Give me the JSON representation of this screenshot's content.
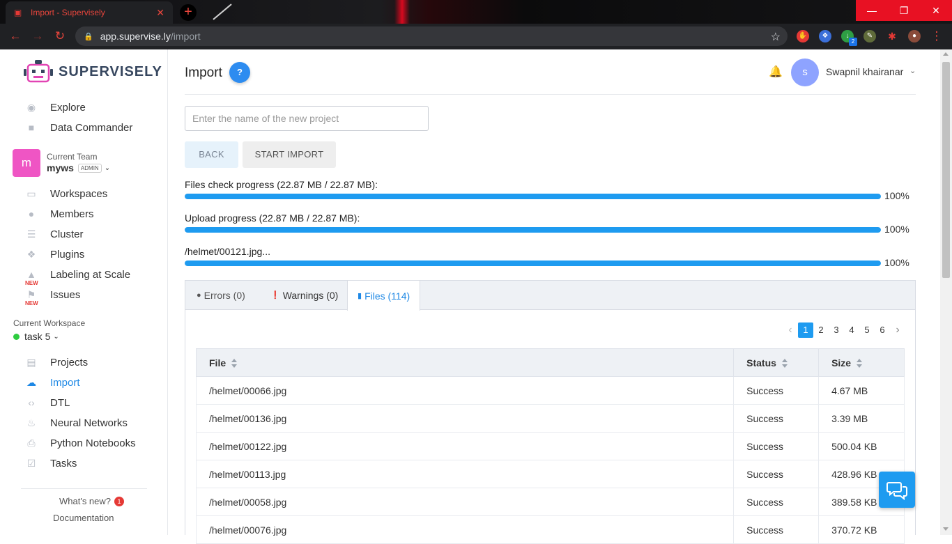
{
  "browser": {
    "tab_title": "Import - Supervisely",
    "url_host": "app.supervise.ly",
    "url_path": "/import",
    "extension_badge": "2"
  },
  "sidebar": {
    "brand": "SUPERVISELY",
    "top_items": [
      {
        "label": "Explore",
        "icon": "globe-icon"
      },
      {
        "label": "Data Commander",
        "icon": "folder-icon"
      }
    ],
    "team": {
      "caption": "Current Team",
      "avatar_letter": "m",
      "name": "myws",
      "role": "ADMIN"
    },
    "team_items": [
      {
        "label": "Workspaces",
        "icon": "monitor-icon"
      },
      {
        "label": "Members",
        "icon": "members-icon"
      },
      {
        "label": "Cluster",
        "icon": "cluster-icon"
      },
      {
        "label": "Plugins",
        "icon": "puzzle-icon"
      },
      {
        "label": "Labeling at Scale",
        "icon": "graduation-cap-icon",
        "tag": "NEW"
      },
      {
        "label": "Issues",
        "icon": "flag-icon",
        "tag": "NEW"
      }
    ],
    "workspace": {
      "caption": "Current Workspace",
      "name": "task 5"
    },
    "workspace_items": [
      {
        "label": "Projects",
        "icon": "images-icon"
      },
      {
        "label": "Import",
        "icon": "cloud-upload-icon",
        "active": true
      },
      {
        "label": "DTL",
        "icon": "code-icon"
      },
      {
        "label": "Neural Networks",
        "icon": "fire-icon"
      },
      {
        "label": "Python Notebooks",
        "icon": "printer-icon"
      },
      {
        "label": "Tasks",
        "icon": "checkbox-icon"
      }
    ],
    "whats_new": "What's new?",
    "whats_new_count": "1",
    "documentation": "Documentation"
  },
  "header": {
    "title": "Import",
    "help": "?",
    "user_initial": "s",
    "user_name": "Swapnil khairanar"
  },
  "form": {
    "project_placeholder": "Enter the name of the new project",
    "project_value": "",
    "back_label": "BACK",
    "start_label": "START IMPORT"
  },
  "progress": [
    {
      "label": "Files check progress (22.87 MB / 22.87 MB):",
      "percent": 100,
      "text": "100%"
    },
    {
      "label": "Upload progress (22.87 MB / 22.87 MB):",
      "percent": 100,
      "text": "100%"
    },
    {
      "label": "/helmet/00121.jpg...",
      "percent": 100,
      "text": "100%"
    }
  ],
  "tabs": [
    {
      "label": "Errors (0)",
      "icon": "error-circle-icon"
    },
    {
      "label": "Warnings (0)",
      "icon": "warning-circle-icon"
    },
    {
      "label": "Files (114)",
      "icon": "file-icon",
      "active": true
    }
  ],
  "pagination": {
    "pages": [
      "1",
      "2",
      "3",
      "4",
      "5",
      "6"
    ],
    "current": "1"
  },
  "table": {
    "columns": [
      "File",
      "Status",
      "Size"
    ],
    "rows": [
      [
        "/helmet/00066.jpg",
        "Success",
        "4.67 MB"
      ],
      [
        "/helmet/00136.jpg",
        "Success",
        "3.39 MB"
      ],
      [
        "/helmet/00122.jpg",
        "Success",
        "500.04 KB"
      ],
      [
        "/helmet/00113.jpg",
        "Success",
        "428.96 KB"
      ],
      [
        "/helmet/00058.jpg",
        "Success",
        "389.58 KB"
      ],
      [
        "/helmet/00076.jpg",
        "Success",
        "370.72 KB"
      ]
    ]
  },
  "colors": {
    "accent": "#1e88e5",
    "progress": "#1e9bf0",
    "team_avatar": "#ef55c4",
    "user_avatar": "#8ea3ff",
    "workspace_dot": "#2ecc40",
    "browser_accent": "#e8453c"
  }
}
